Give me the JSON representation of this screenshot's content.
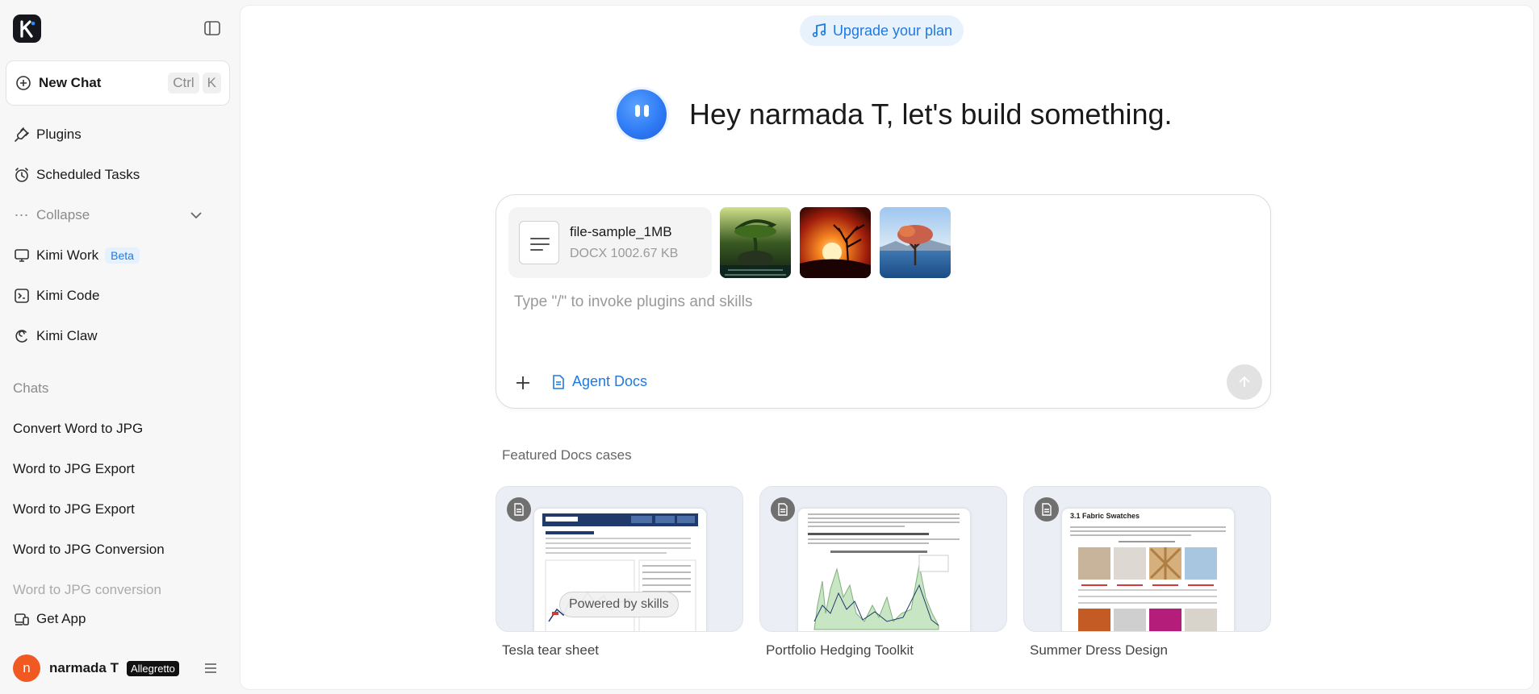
{
  "sidebar": {
    "new_chat_label": "New Chat",
    "shortcut_keys": [
      "Ctrl",
      "K"
    ],
    "nav": [
      {
        "label": "Plugins",
        "icon": "plug-icon"
      },
      {
        "label": "Scheduled Tasks",
        "icon": "alarm-clock-icon"
      },
      {
        "label": "Collapse",
        "icon": "ellipsis-icon"
      },
      {
        "label": "Kimi Work",
        "icon": "monitor-icon",
        "badge": "Beta"
      },
      {
        "label": "Kimi Code",
        "icon": "terminal-icon"
      },
      {
        "label": "Kimi Claw",
        "icon": "claw-icon"
      }
    ],
    "chats_label": "Chats",
    "chats": [
      "Convert Word to JPG",
      "Word to JPG Export",
      "Word to JPG Export",
      "Word to JPG Conversion",
      "Word to JPG conversion"
    ],
    "get_app_label": "Get App",
    "user": {
      "initial": "n",
      "name": "narmada T",
      "plan": "Allegretto"
    }
  },
  "main": {
    "upgrade_label": "Upgrade your plan",
    "greeting": "Hey narmada T, let's build something.",
    "composer": {
      "file": {
        "name": "file-sample_1MB",
        "meta": "DOCX 1002.67 KB"
      },
      "placeholder": "Type \"/\" to invoke plugins and skills",
      "agent_label": "Agent Docs"
    },
    "featured_label": "Featured Docs cases",
    "cases": [
      {
        "title": "Tesla tear sheet",
        "overlay": "Powered by skills"
      },
      {
        "title": "Portfolio Hedging Toolkit"
      },
      {
        "title": "Summer Dress Design",
        "doc_heading": "3.1 Fabric Swatches"
      }
    ]
  },
  "colors": {
    "accent": "#1f7ae0",
    "avatar": "#f05a22",
    "mascot": "#2f7bf5"
  }
}
